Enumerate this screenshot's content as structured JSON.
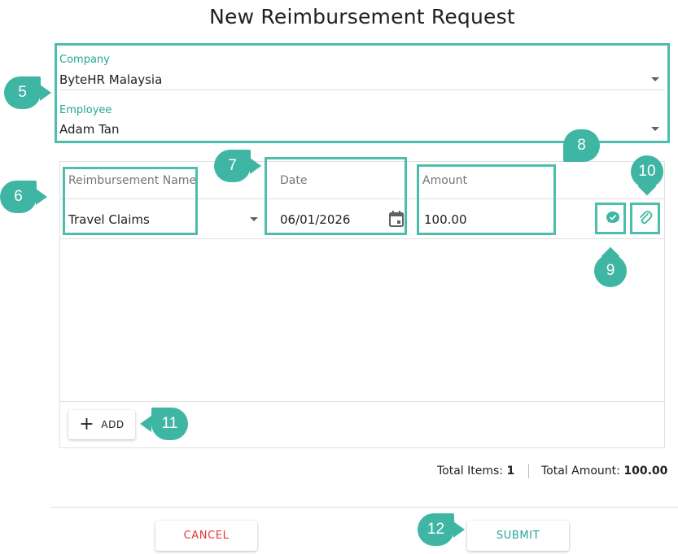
{
  "dialog": {
    "title": "New Reimbursement Request"
  },
  "company": {
    "label": "Company",
    "value": "ByteHR Malaysia"
  },
  "employee": {
    "label": "Employee",
    "value": "Adam Tan"
  },
  "table": {
    "columns": {
      "name": "Reimbursement Name",
      "date": "Date",
      "amount": "Amount"
    },
    "rows": [
      {
        "name": "Travel Claims",
        "date": "06/01/2026",
        "amount": "100.00"
      }
    ],
    "add_label": "ADD"
  },
  "summary": {
    "items_label": "Total Items:",
    "items_value": "1",
    "amount_label": "Total Amount:",
    "amount_value": "100.00"
  },
  "buttons": {
    "cancel": "CANCEL",
    "submit": "SUBMIT"
  },
  "callouts": {
    "c5": "5",
    "c6": "6",
    "c7": "7",
    "c8": "8",
    "c9": "9",
    "c10": "10",
    "c11": "11",
    "c12": "12"
  },
  "colors": {
    "accent": "#26a69a",
    "callout": "#3fb5a3",
    "cancel": "#e53935",
    "highlight": "#4dbdad"
  },
  "icons": {
    "date_picker": "calendar-icon",
    "comment": "comment-check-icon",
    "attachment": "paperclip-icon",
    "add": "plus-icon",
    "dropdown": "caret-down-icon"
  }
}
